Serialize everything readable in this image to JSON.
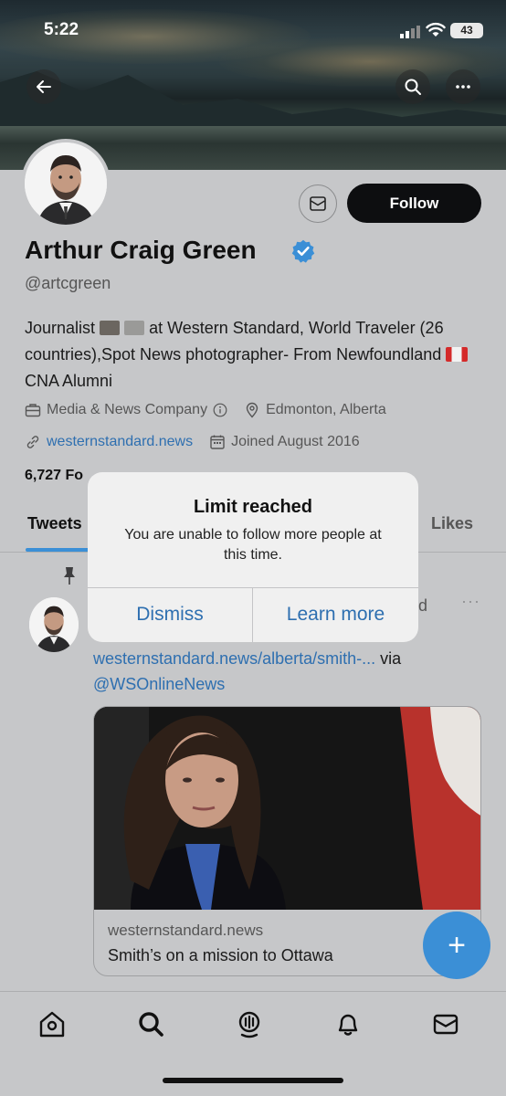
{
  "status_bar": {
    "time": "5:22",
    "battery": "43"
  },
  "header": {
    "back_icon": "back-arrow-icon",
    "search_icon": "search-icon",
    "more_icon": "more-icon"
  },
  "profile": {
    "name": "Arthur Craig Green",
    "handle": "@artcgreen",
    "follow_label": "Follow",
    "bio_part1": "Journalist",
    "bio_part2": "at Western Standard, World Traveler (26 countries),Spot News photographer- From Newfoundland",
    "bio_part3": "CNA Alumni",
    "category": "Media & News Company",
    "location": "Edmonton, Alberta",
    "website": "westernstandard.news",
    "joined": "Joined August 2016",
    "followers_partial": "6,727 Fo"
  },
  "tabs": {
    "tweets": "Tweets",
    "likes": "Likes"
  },
  "tweet": {
    "tail": "d",
    "more": "···",
    "link": "westernstandard.news/alberta/smith-...",
    "via": "via",
    "mention": "@WSOnlineNews",
    "card_domain": "westernstandard.news",
    "card_title": "Smith’s on a mission to Ottawa"
  },
  "dialog": {
    "title": "Limit reached",
    "message": "You are unable to follow more people at this time.",
    "dismiss": "Dismiss",
    "learn_more": "Learn more"
  },
  "fab_label": "+",
  "colors": {
    "accent": "#3b8fd6",
    "link": "#2e6fb0",
    "follow_bg": "#0d0e10"
  }
}
